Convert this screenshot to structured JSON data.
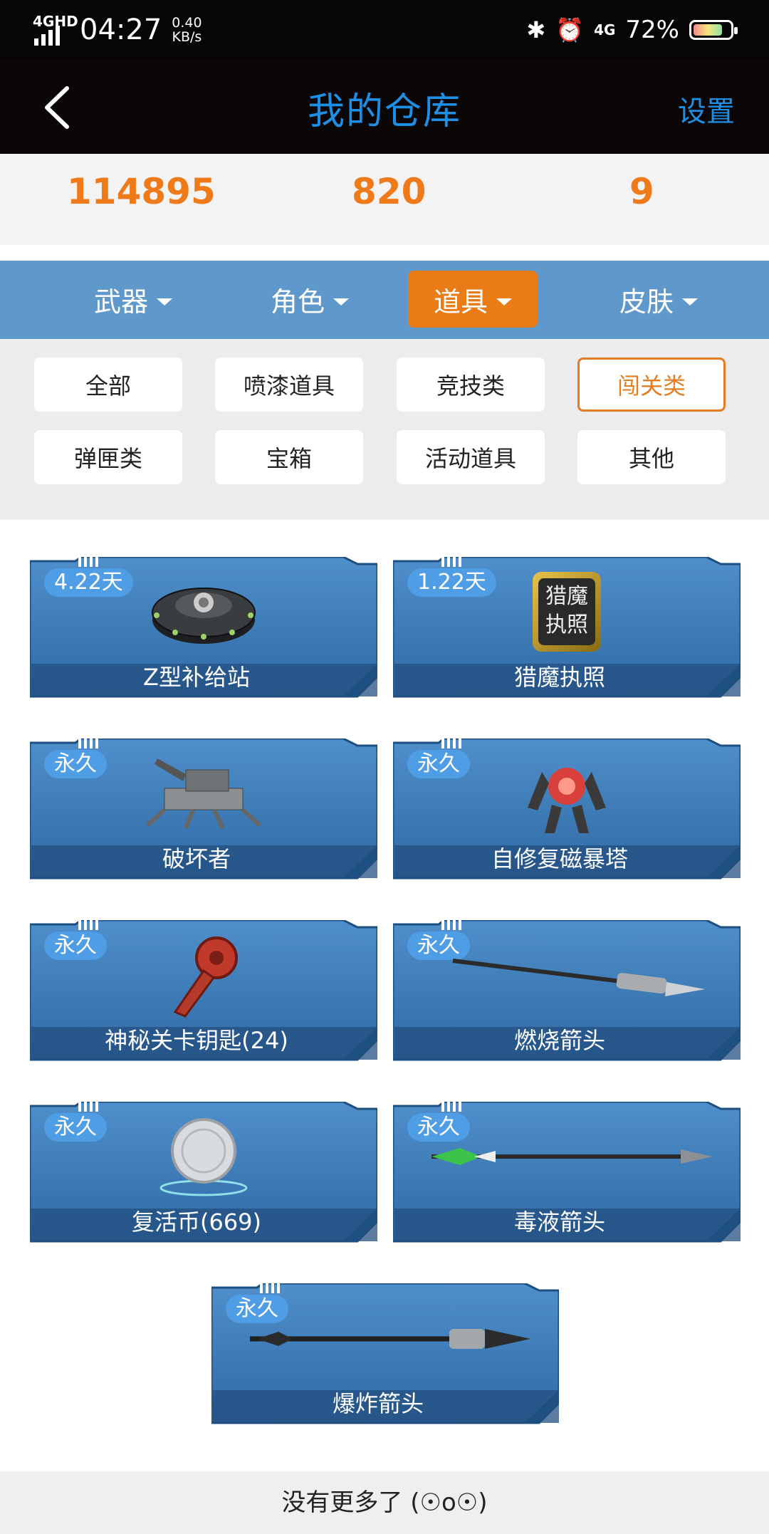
{
  "status_bar": {
    "network": "4GHD",
    "time": "04:27",
    "speed_value": "0.40",
    "speed_unit": "KB/s",
    "signal_right": "4G",
    "battery": "72%"
  },
  "header": {
    "title": "我的仓库",
    "settings_label": "设置"
  },
  "stats": [
    "114895",
    "820",
    "9"
  ],
  "categories": [
    {
      "label": "武器",
      "active": false
    },
    {
      "label": "角色",
      "active": false
    },
    {
      "label": "道具",
      "active": true
    },
    {
      "label": "皮肤",
      "active": false
    }
  ],
  "filters": [
    {
      "label": "全部",
      "active": false
    },
    {
      "label": "喷漆道具",
      "active": false
    },
    {
      "label": "竞技类",
      "active": false
    },
    {
      "label": "闯关类",
      "active": true
    },
    {
      "label": "弹匣类",
      "active": false
    },
    {
      "label": "宝箱",
      "active": false
    },
    {
      "label": "活动道具",
      "active": false
    },
    {
      "label": "其他",
      "active": false
    }
  ],
  "items": [
    {
      "badge": "4.22天",
      "name": "Z型补给站",
      "icon": "supply-station-icon"
    },
    {
      "badge": "1.22天",
      "name": "猎魔执照",
      "icon": "hunter-license-icon"
    },
    {
      "badge": "永久",
      "name": "破坏者",
      "icon": "destroyer-turret-icon"
    },
    {
      "badge": "永久",
      "name": "自修复磁暴塔",
      "icon": "tesla-tower-icon"
    },
    {
      "badge": "永久",
      "name": "神秘关卡钥匙(24)",
      "icon": "key-icon"
    },
    {
      "badge": "永久",
      "name": "燃烧箭头",
      "icon": "fire-arrow-icon"
    },
    {
      "badge": "永久",
      "name": "复活币(669)",
      "icon": "revive-coin-icon"
    },
    {
      "badge": "永久",
      "name": "毒液箭头",
      "icon": "venom-arrow-icon"
    },
    {
      "badge": "永久",
      "name": "爆炸箭头",
      "icon": "explosive-arrow-icon"
    }
  ],
  "license_icon_text": "猎魔执照",
  "footer": "没有更多了 (☉o☉)",
  "colors": {
    "accent_orange": "#ea7c18",
    "title_blue": "#1e8fe6",
    "category_bar": "#5f99cc",
    "card_blue": "#3b78b3"
  }
}
